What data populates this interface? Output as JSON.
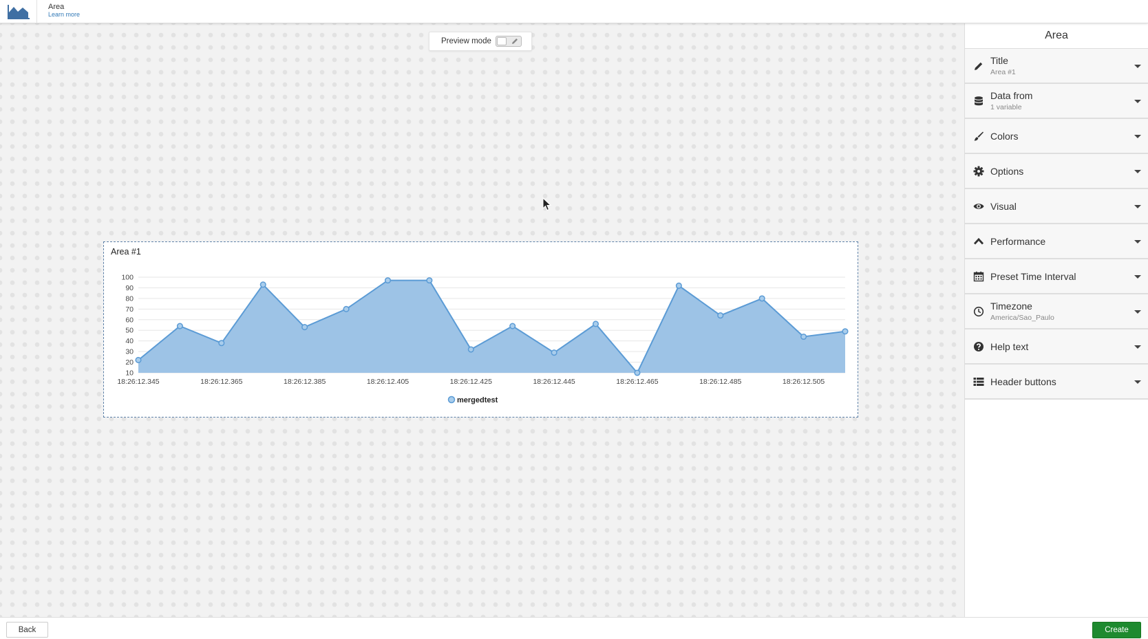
{
  "header": {
    "app_icon": "area-chart-icon",
    "title": "Area",
    "learn_more": "Learn more"
  },
  "preview": {
    "label": "Preview mode",
    "enabled": false
  },
  "widget": {
    "title": "Area #1"
  },
  "chart_data": {
    "type": "area",
    "yticks": [
      10,
      20,
      30,
      40,
      50,
      60,
      70,
      80,
      90,
      100
    ],
    "ylim": [
      10,
      100
    ],
    "xtick_labels": [
      "18:26:12.345",
      "18:26:12.365",
      "18:26:12.385",
      "18:26:12.405",
      "18:26:12.425",
      "18:26:12.445",
      "18:26:12.465",
      "18:26:12.485",
      "18:26:12.505"
    ],
    "x": [
      345,
      355,
      365,
      375,
      385,
      395,
      405,
      415,
      425,
      435,
      445,
      455,
      465,
      475,
      485,
      495,
      505,
      515
    ],
    "series": [
      {
        "name": "mergedtest",
        "color": "#5b9bd5",
        "values": [
          22,
          54,
          38,
          93,
          53,
          70,
          97,
          97,
          32,
          54,
          29,
          56,
          10,
          92,
          64,
          80,
          44,
          49
        ]
      }
    ],
    "grid": true,
    "legend": "bottom-center"
  },
  "panel": {
    "title": "Area",
    "sections": [
      {
        "label": "Title",
        "sub": "Area #1",
        "icon": "pencil-icon"
      },
      {
        "label": "Data from",
        "sub": "1 variable",
        "icon": "database-icon"
      },
      {
        "label": "Colors",
        "sub": "",
        "icon": "brush-icon"
      },
      {
        "label": "Options",
        "sub": "",
        "icon": "gear-icon"
      },
      {
        "label": "Visual",
        "sub": "",
        "icon": "eye-icon"
      },
      {
        "label": "Performance",
        "sub": "",
        "icon": "chevron-up-icon"
      },
      {
        "label": "Preset Time Interval",
        "sub": "",
        "icon": "calendar-icon"
      },
      {
        "label": "Timezone",
        "sub": "America/Sao_Paulo",
        "icon": "clock-icon"
      },
      {
        "label": "Help text",
        "sub": "",
        "icon": "question-circle-icon"
      },
      {
        "label": "Header buttons",
        "sub": "",
        "icon": "list-icon"
      }
    ]
  },
  "footer": {
    "back": "Back",
    "create": "Create"
  },
  "colors": {
    "accent": "#5b9bd5",
    "create_button": "#1e8a2f",
    "link": "#337ab7"
  }
}
